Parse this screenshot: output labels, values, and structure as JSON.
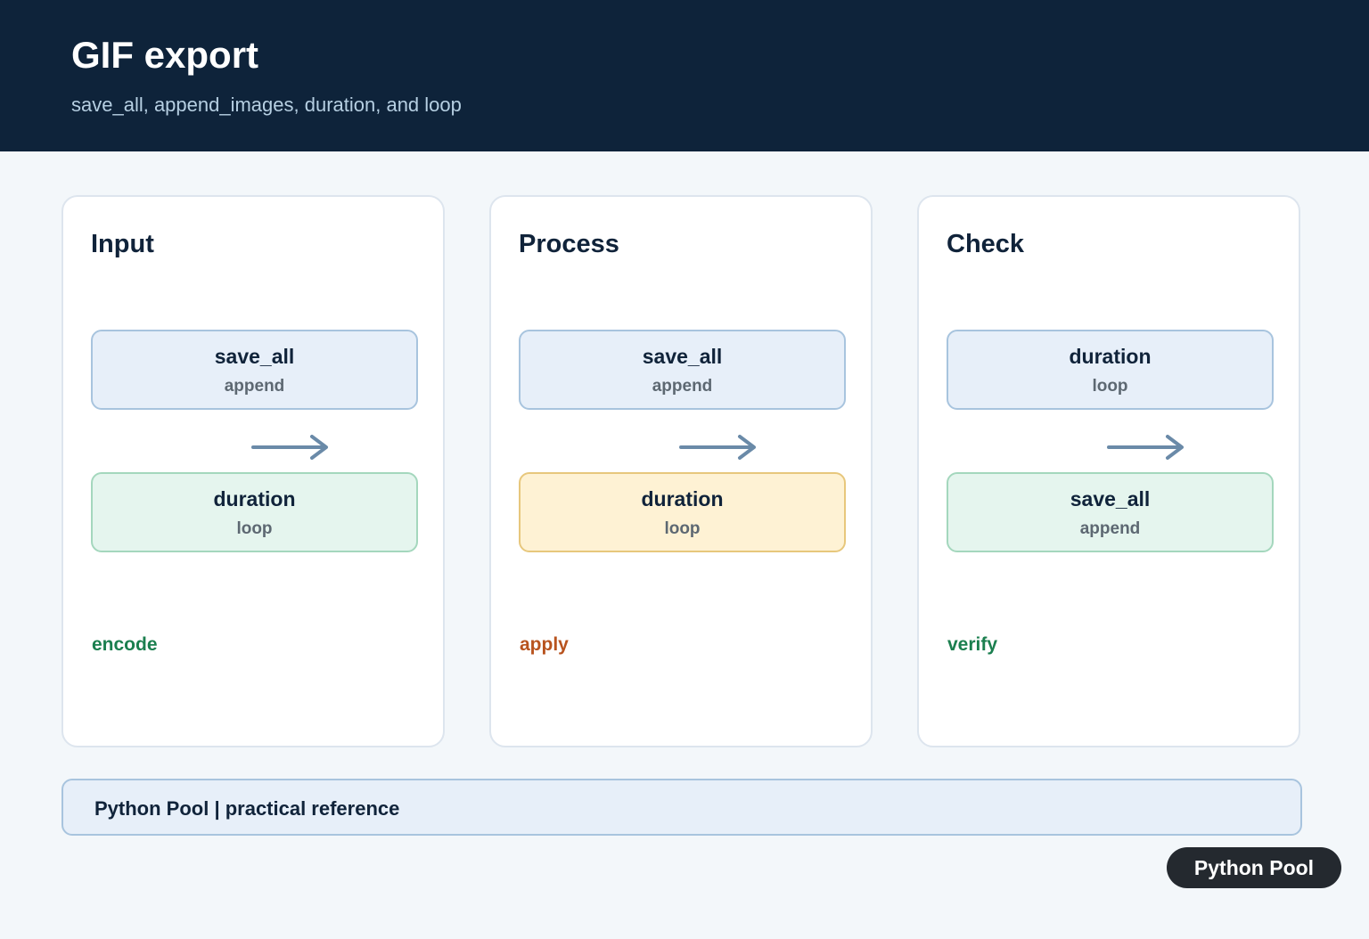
{
  "header": {
    "title": "GIF export",
    "subtitle": "save_all, append_images, duration, and loop"
  },
  "panels": [
    {
      "title": "Input",
      "top_box": {
        "main": "save_all",
        "sub": "append",
        "color": "#e7eff9"
      },
      "bottom_box": {
        "main": "duration",
        "sub": "loop",
        "color": "#e5f5ee"
      },
      "step": "encode",
      "step_color": "#1b7f4f"
    },
    {
      "title": "Process",
      "top_box": {
        "main": "save_all",
        "sub": "append",
        "color": "#e7eff9"
      },
      "bottom_box": {
        "main": "duration",
        "sub": "loop",
        "color": "#fef2d4"
      },
      "step": "apply",
      "step_color": "#b8531e"
    },
    {
      "title": "Check",
      "top_box": {
        "main": "duration",
        "sub": "loop",
        "color": "#e7eff9"
      },
      "bottom_box": {
        "main": "save_all",
        "sub": "append",
        "color": "#e5f5ee"
      },
      "step": "verify",
      "step_color": "#1b7f4f"
    }
  ],
  "footer": {
    "text": "Python Pool | practical reference"
  },
  "badge": {
    "label": "Python Pool"
  },
  "icons": {
    "flow_arrow": "arrow-right-icon",
    "arrow_color": "#6a8aa8"
  }
}
